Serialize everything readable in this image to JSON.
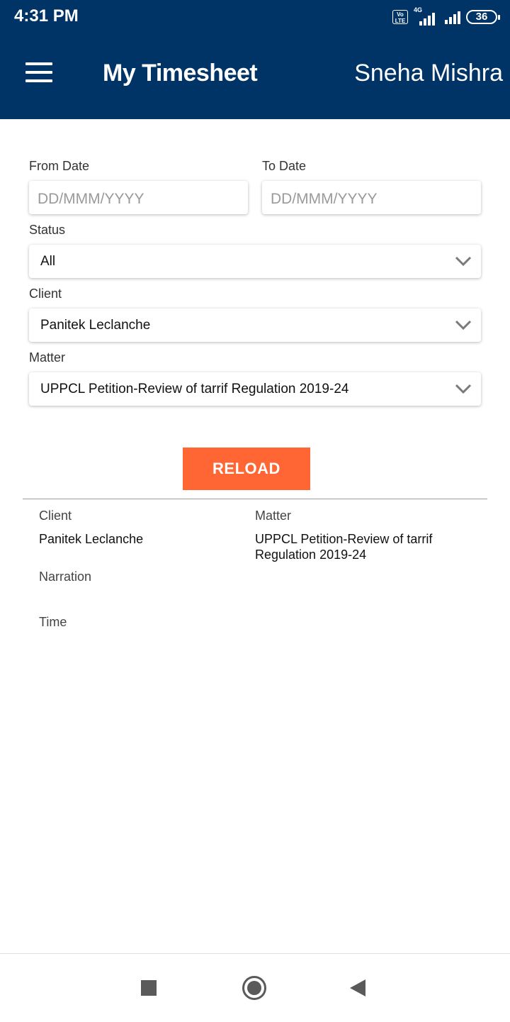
{
  "status_bar": {
    "time": "4:31 PM",
    "volte_label": "Vo\nLTE",
    "network_label": "4G",
    "battery": "36"
  },
  "header": {
    "title": "My Timesheet",
    "user_name": "Sneha Mishra",
    "menu_icon": "hamburger-menu-icon"
  },
  "filters": {
    "from_date": {
      "label": "From Date",
      "placeholder": "DD/MMM/YYYY",
      "value": ""
    },
    "to_date": {
      "label": "To Date",
      "placeholder": "DD/MMM/YYYY",
      "value": ""
    },
    "status": {
      "label": "Status",
      "selected": "All"
    },
    "client": {
      "label": "Client",
      "selected": "Panitek Leclanche"
    },
    "matter": {
      "label": "Matter",
      "selected": "UPPCL Petition-Review of tarrif Regulation 2019-24"
    },
    "reload_label": "RELOAD"
  },
  "result": {
    "client_label": "Client",
    "client_value": "Panitek Leclanche",
    "matter_label": "Matter",
    "matter_value": "UPPCL Petition-Review of tarrif Regulation 2019-24",
    "narration_label": "Narration",
    "time_label": "Time"
  },
  "colors": {
    "header_bg": "#003366",
    "accent_button": "#ff6633"
  },
  "nav_bar": {
    "icons": [
      "recents-square-icon",
      "home-circle-icon",
      "back-triangle-icon"
    ]
  }
}
